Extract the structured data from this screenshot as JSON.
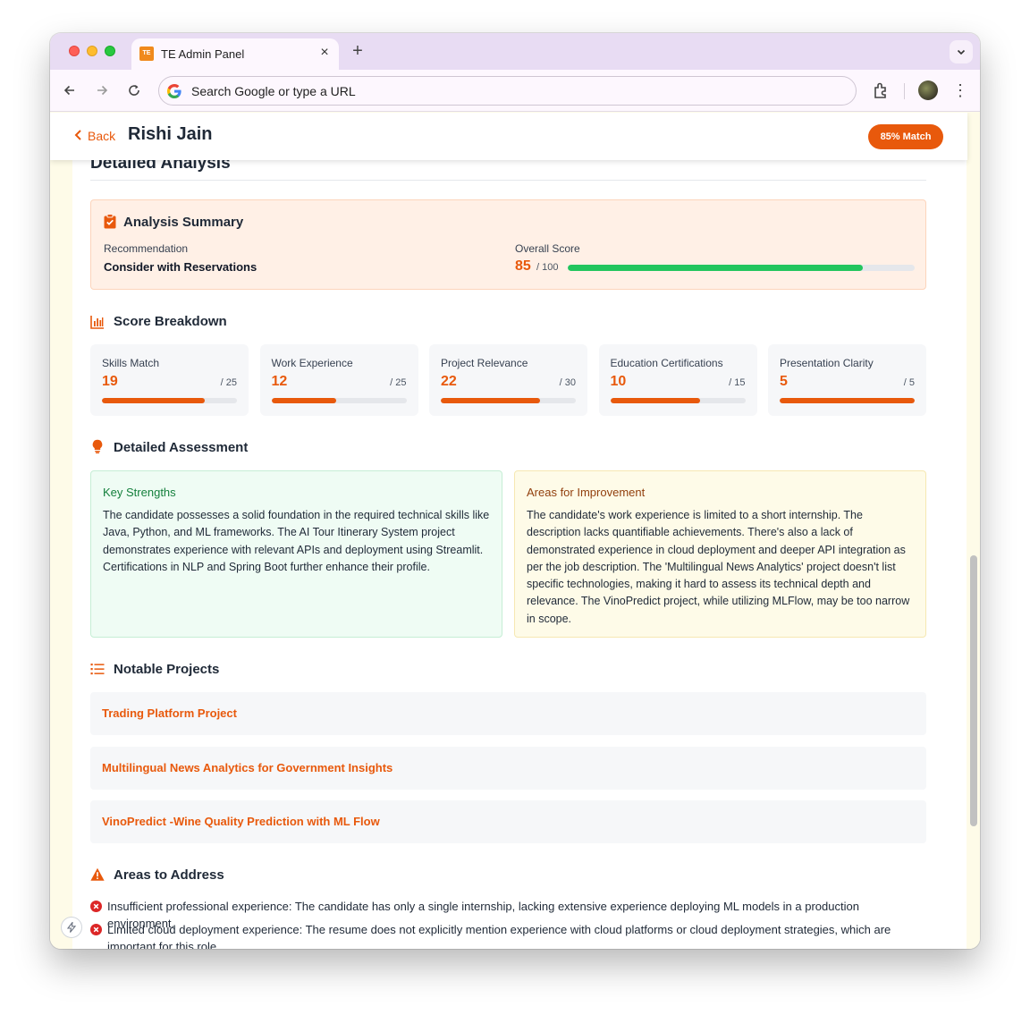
{
  "browser": {
    "tab_title": "TE Admin Panel",
    "tab_favicon_text": "TE",
    "tab_close": "×",
    "new_tab": "+",
    "omnibox_placeholder": "Search Google or type a URL",
    "menu_dots": "⋮"
  },
  "header": {
    "back_label": "Back",
    "candidate_name": "Rishi Jain",
    "match_badge": "85% Match"
  },
  "analysis": {
    "section_title": "Detailed Analysis",
    "summary": {
      "title": "Analysis Summary",
      "recommendation_label": "Recommendation",
      "recommendation_value": "Consider with Reservations",
      "overall_label": "Overall Score",
      "overall_value": "85",
      "overall_max": "/ 100",
      "overall_fraction": 0.85
    },
    "breakdown": {
      "title": "Score Breakdown",
      "items": [
        {
          "label": "Skills Match",
          "value": "19",
          "max": "/ 25",
          "fraction": 0.76
        },
        {
          "label": "Work Experience",
          "value": "12",
          "max": "/ 25",
          "fraction": 0.48
        },
        {
          "label": "Project Relevance",
          "value": "22",
          "max": "/ 30",
          "fraction": 0.733
        },
        {
          "label": "Education Certifications",
          "value": "10",
          "max": "/ 15",
          "fraction": 0.667
        },
        {
          "label": "Presentation Clarity",
          "value": "5",
          "max": "/ 5",
          "fraction": 1.0
        }
      ]
    },
    "assessment": {
      "title": "Detailed Assessment",
      "strengths_title": "Key Strengths",
      "strengths_text": "The candidate possesses a solid foundation in the required technical skills like Java, Python, and ML frameworks. The AI Tour Itinerary System project demonstrates experience with relevant APIs and deployment using Streamlit. Certifications in NLP and Spring Boot further enhance their profile.",
      "improvement_title": "Areas for Improvement",
      "improvement_text": "The candidate's work experience is limited to a short internship. The description lacks quantifiable achievements. There's also a lack of demonstrated experience in cloud deployment and deeper API integration as per the job description. The 'Multilingual News Analytics' project doesn't list specific technologies, making it hard to assess its technical depth and relevance. The VinoPredict project, while utilizing MLFlow, may be too narrow in scope."
    },
    "projects": {
      "title": "Notable Projects",
      "items": [
        "Trading Platform Project",
        "Multilingual News Analytics for Government Insights",
        "VinoPredict -Wine Quality Prediction with ML Flow"
      ]
    },
    "areas": {
      "title": "Areas to Address",
      "items": [
        "Insufficient professional experience: The candidate has only a single internship, lacking extensive experience deploying ML models in a production environment.",
        "Limited cloud deployment experience: The resume does not explicitly mention experience with cloud platforms or cloud deployment strategies, which are important for this role."
      ]
    }
  },
  "colors": {
    "accent": "#e8590c",
    "success": "#22c55e",
    "strengths_title": "#15803d",
    "improvement_title": "#92400e",
    "error_icon": "#dc2626"
  },
  "icons": {
    "back": "chevron-left-icon",
    "summary": "clipboard-check-icon",
    "breakdown": "bar-chart-icon",
    "assessment": "lightbulb-icon",
    "projects": "list-icon",
    "areas": "warning-triangle-icon",
    "issue": "x-circle-icon"
  }
}
